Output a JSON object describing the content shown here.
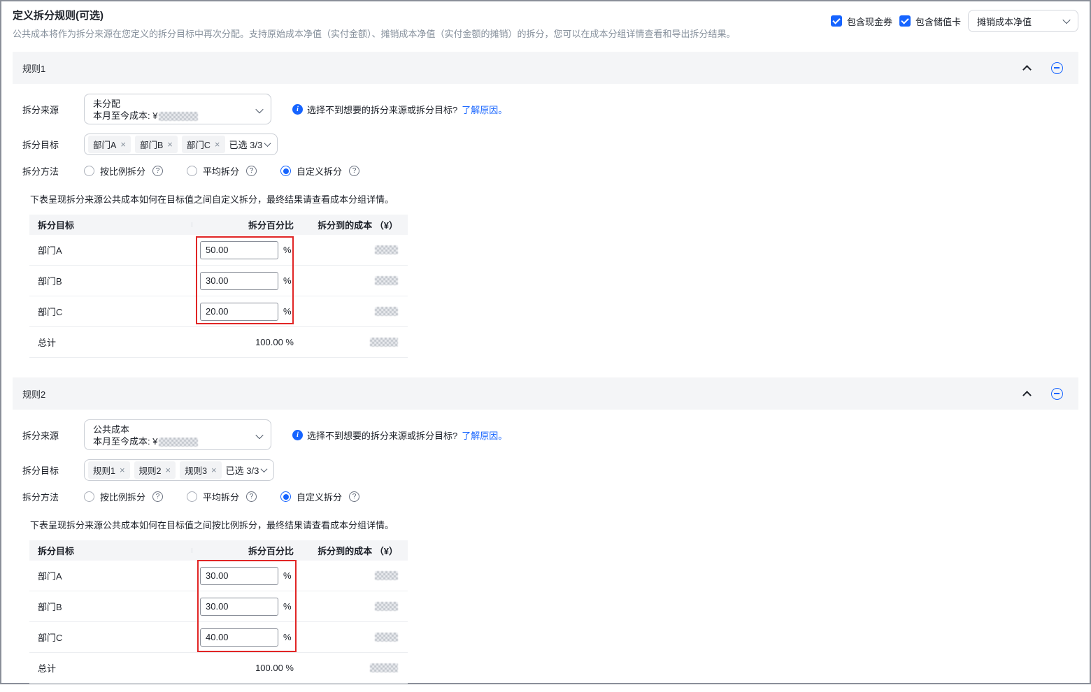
{
  "page": {
    "title": "定义拆分规则(可选)",
    "subtitle": "公共成本将作为拆分来源在您定义的拆分目标中再次分配。支持原始成本净值（实付金额）、摊销成本净值（实付金额的摊销）的拆分，您可以在成本分组详情查看和导出拆分结果。"
  },
  "top_controls": {
    "checkboxes": [
      {
        "label": "包含现金券",
        "checked": true
      },
      {
        "label": "包含储值卡",
        "checked": true
      }
    ],
    "cost_type_select": {
      "value": "摊销成本净值"
    }
  },
  "labels": {
    "source": "拆分来源",
    "target": "拆分目标",
    "method": "拆分方法",
    "mtd_prefix": "本月至今成本: ¥",
    "selected_count": "已选 3/3",
    "help_text": "选择不到想要的拆分来源或拆分目标?",
    "help_link": "了解原因。",
    "percent_sign": "%",
    "total_label": "总计",
    "total_percent": "100.00 %"
  },
  "methods": [
    {
      "label": "按比例拆分"
    },
    {
      "label": "平均拆分"
    },
    {
      "label": "自定义拆分"
    }
  ],
  "table_headers": [
    "拆分目标",
    "拆分百分比",
    "拆分到的成本 （¥）"
  ],
  "rules": [
    {
      "name": "规则1",
      "source": "未分配",
      "targets": [
        "部门A",
        "部门B",
        "部门C"
      ],
      "selected_method": "自定义拆分",
      "table_note": "下表呈现拆分来源公共成本如何在目标值之间自定义拆分，最终结果请查看成本分组详情。",
      "rows": [
        {
          "target": "部门A",
          "percent": "50.00"
        },
        {
          "target": "部门B",
          "percent": "30.00"
        },
        {
          "target": "部门C",
          "percent": "20.00"
        }
      ]
    },
    {
      "name": "规则2",
      "source": "公共成本",
      "targets": [
        "规则1",
        "规则2",
        "规则3"
      ],
      "selected_method": "自定义拆分",
      "table_note": "下表呈现拆分来源公共成本如何在目标值之间按比例拆分，最终结果请查看成本分组详情。",
      "rows": [
        {
          "target": "部门A",
          "percent": "30.00"
        },
        {
          "target": "部门B",
          "percent": "30.00"
        },
        {
          "target": "部门C",
          "percent": "40.00"
        }
      ]
    }
  ],
  "colors": {
    "accent": "#1664ff",
    "annotation": "#e12525"
  }
}
